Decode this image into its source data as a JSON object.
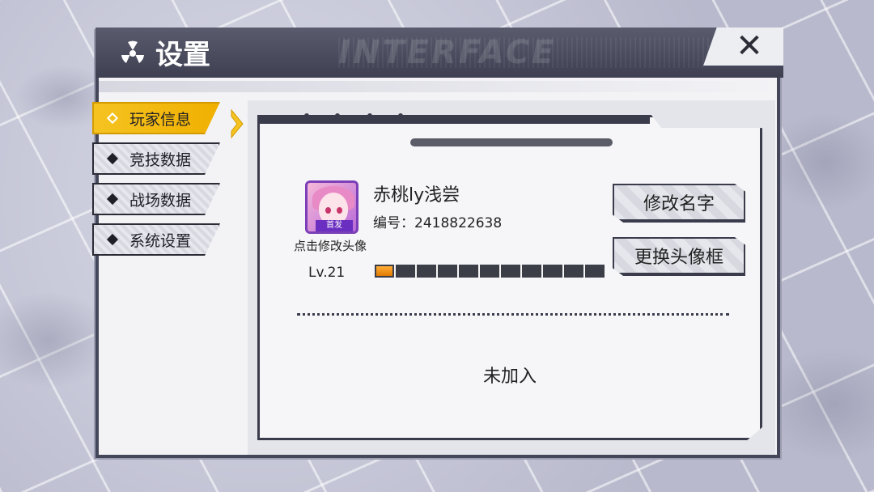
{
  "window": {
    "title": "设置",
    "decorative_text": "INTERFACE",
    "close_label": "✕"
  },
  "sidebar": {
    "items": [
      {
        "label": "玩家信息",
        "active": true
      },
      {
        "label": "竞技数据",
        "active": false
      },
      {
        "label": "战场数据",
        "active": false
      },
      {
        "label": "系统设置",
        "active": false
      }
    ]
  },
  "player": {
    "name": "赤桃ly浅尝",
    "id_text": "编号：2418822638",
    "avatar_badge": "首发",
    "avatar_hint": "点击修改头像",
    "level_text": "Lv.21",
    "exp_fraction": 0.09,
    "exp_segments_total": 11,
    "exp_segments_filled": 1
  },
  "actions": {
    "rename_label": "修改名字",
    "change_frame_label": "更换头像框"
  },
  "guild": {
    "status_text": "未加入"
  },
  "colors": {
    "accent": "#f5c321",
    "frame": "#44465a",
    "exp_fill": "#f0a020"
  }
}
